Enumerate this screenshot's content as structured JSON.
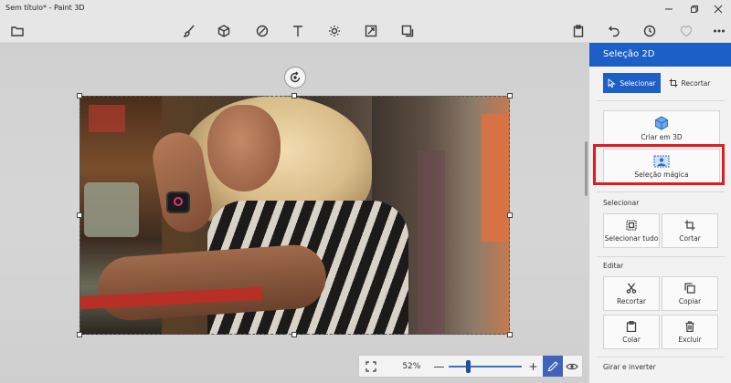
{
  "window": {
    "title": "Sem título* - Paint 3D"
  },
  "colors": {
    "accent": "#1c5fc7",
    "highlight": "#e01b22",
    "panel_bg": "#f2f2f2"
  },
  "toolbar": {
    "left_icons": [
      "folder-icon"
    ],
    "tools": [
      "brushes-icon",
      "shapes-3d-icon",
      "stickers-icon",
      "text-icon",
      "effects-icon",
      "canvas-icon",
      "library-3d-icon"
    ],
    "right_icons": [
      "paste-icon",
      "undo-icon",
      "history-icon",
      "redo-icon",
      "more-icon"
    ]
  },
  "zoom": {
    "percent": "52%",
    "minus": "—",
    "plus": "+",
    "level": 0.26
  },
  "panel": {
    "title": "Seleção 2D",
    "tab_select": "Selecionar",
    "tab_crop": "Recortar",
    "create_3d": "Criar em 3D",
    "magic_select": "Seleção mágica",
    "section_select": "Selecionar",
    "select_all": "Selecionar tudo",
    "crop": "Cortar",
    "section_edit": "Editar",
    "cut": "Recortar",
    "copy": "Copiar",
    "paste": "Colar",
    "delete": "Excluir",
    "section_rotate": "Girar e inverter"
  }
}
